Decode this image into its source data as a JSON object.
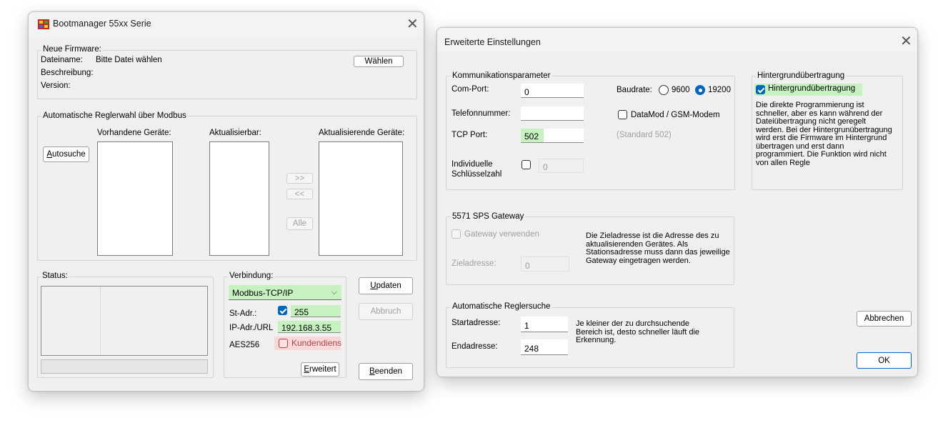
{
  "bootmanager": {
    "title": "Bootmanager 55xx Serie",
    "firmware": {
      "legend": "Neue Firmware:",
      "filename_label": "Dateiname:",
      "filename_value": "Bitte Datei wählen",
      "description_label": "Beschreibung:",
      "version_label": "Version:",
      "choose_button": "Wählen"
    },
    "auto": {
      "legend": "Automatische Reglerwahl über Modbus",
      "col_available": "Vorhandene Geräte:",
      "col_updatable": "Aktualisierbar:",
      "col_updating": "Aktualisierende Geräte:",
      "autosearch_prefix": "A",
      "autosearch_rest": "utosuche",
      "move_right": ">>",
      "move_left": "<<",
      "all": "Alle"
    },
    "status": {
      "legend": "Status:"
    },
    "connection": {
      "legend": "Verbindung:",
      "protocol": "Modbus-TCP/IP",
      "st_adr_label": "St-Adr.:",
      "st_adr_value": "255",
      "ip_label": "IP-Adr./URL",
      "ip_value": "192.168.3.55",
      "aes_label": "AES256",
      "customer_service": "Kundendiens",
      "advanced_prefix": "E",
      "advanced_rest": "rweitert"
    },
    "buttons": {
      "update_prefix": "U",
      "update_rest": "pdaten",
      "abort": "Abbruch",
      "exit_prefix": "B",
      "exit_rest": "eenden"
    }
  },
  "settings": {
    "title": "Erweiterte Einstellungen",
    "comm": {
      "legend": "Kommunikationsparameter",
      "com_port_label": "Com-Port:",
      "com_port_value": "0",
      "phone_label": "Telefonnummer:",
      "phone_value": "",
      "tcp_port_label": "TCP Port:",
      "tcp_port_value": "502",
      "key_label_1": "Individuelle",
      "key_label_2": "Schlüsselzahl",
      "key_value": "0",
      "baud_label": "Baudrate:",
      "baud_9600": "9600",
      "baud_19200": "19200",
      "datamod": "DataMod / GSM-Modem",
      "standard_hint": "(Standard 502)"
    },
    "background": {
      "legend": "Hintergrundübertragung",
      "checkbox": "Hintergrundübertragung",
      "description": "Die direkte Programmierung ist schneller, aber  es kann während der Dateiübertragung nicht geregelt werden.  Bei der Hintergrunübertragung wird erst die Firmware im Hintergrund übertragen und erst dann programmiert. Die Funktion wird nicht von allen Regle"
    },
    "gateway": {
      "legend": "5571 SPS Gateway",
      "use_gateway": "Gateway verwenden",
      "target_label": "Zieladresse:",
      "target_value": "0",
      "description": "Die Zieladresse ist die Adresse des zu aktualisierenden Gerätes. Als Stationsadresse muss dann das jeweilige Gateway eingetragen werden."
    },
    "autosearch": {
      "legend": "Automatische Reglersuche",
      "start_label": "Startadresse:",
      "start_value": "1",
      "end_label": "Endadresse:",
      "end_value": "248",
      "description": "Je kleiner der zu durchsuchende Bereich ist, desto schneller läuft die Erkennung."
    },
    "cancel": "Abbrechen",
    "ok": "OK"
  }
}
